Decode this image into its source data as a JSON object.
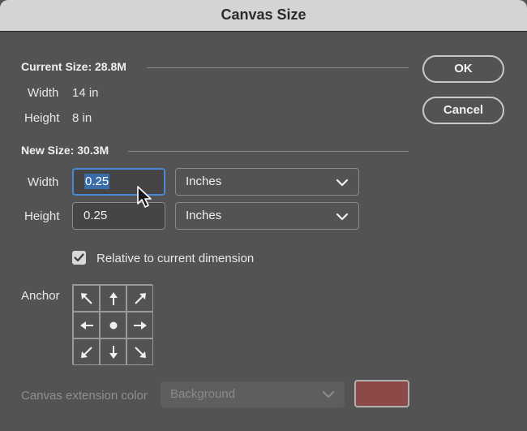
{
  "dialog": {
    "title": "Canvas Size"
  },
  "current_size": {
    "label": "Current Size: 28.8M",
    "width_label": "Width",
    "width_value": "14 in",
    "height_label": "Height",
    "height_value": "8 in"
  },
  "new_size": {
    "label": "New Size: 30.3M",
    "width_label": "Width",
    "width_value": "0.25",
    "width_unit": "Inches",
    "height_label": "Height",
    "height_value": "0.25",
    "height_unit": "Inches",
    "relative_label": "Relative to current dimension",
    "relative_checked": true
  },
  "anchor": {
    "label": "Anchor",
    "cells": [
      {
        "name": "anchor-top-left",
        "icon": "arrow-up-left-icon"
      },
      {
        "name": "anchor-top",
        "icon": "arrow-up-icon"
      },
      {
        "name": "anchor-top-right",
        "icon": "arrow-up-right-icon"
      },
      {
        "name": "anchor-left",
        "icon": "arrow-left-icon"
      },
      {
        "name": "anchor-center",
        "icon": "dot-icon"
      },
      {
        "name": "anchor-right",
        "icon": "arrow-right-icon"
      },
      {
        "name": "anchor-bottom-left",
        "icon": "arrow-down-left-icon"
      },
      {
        "name": "anchor-bottom",
        "icon": "arrow-down-icon"
      },
      {
        "name": "anchor-bottom-right",
        "icon": "arrow-down-right-icon"
      }
    ]
  },
  "extension": {
    "label": "Canvas extension color",
    "value": "Background",
    "swatch_color": "#8b4a47"
  },
  "buttons": {
    "ok": "OK",
    "cancel": "Cancel"
  },
  "colors": {
    "focus": "#4a88d6",
    "dialog_bg": "#535353"
  }
}
